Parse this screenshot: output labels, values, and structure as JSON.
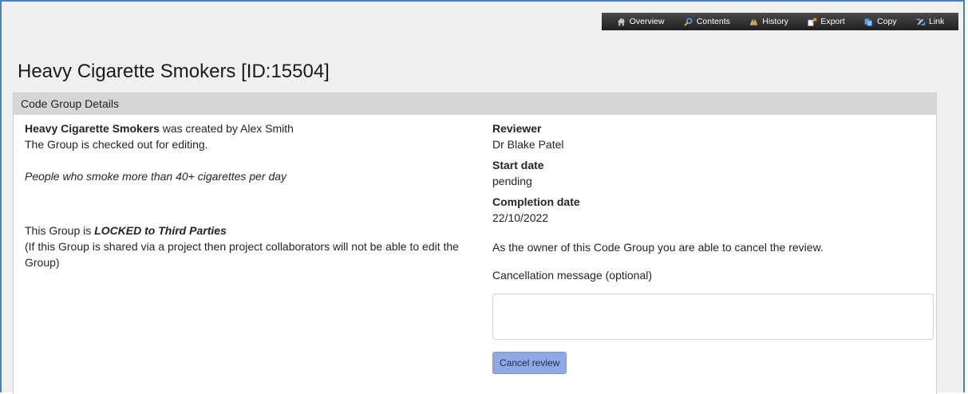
{
  "toolbar": {
    "items": [
      {
        "label": "Overview",
        "icon": "home-icon"
      },
      {
        "label": "Contents",
        "icon": "search-icon"
      },
      {
        "label": "History",
        "icon": "history-icon"
      },
      {
        "label": "Export",
        "icon": "export-icon"
      },
      {
        "label": "Copy",
        "icon": "copy-icon"
      },
      {
        "label": "Link",
        "icon": "link-icon"
      }
    ]
  },
  "page": {
    "title": "Heavy Cigarette Smokers [ID:15504]"
  },
  "panel": {
    "header": "Code Group Details",
    "left": {
      "group_name": "Heavy Cigarette Smokers",
      "created_by": " was created by Alex Smith",
      "checked_out": "The Group is checked out for editing.",
      "description": "People who smoke more than 40+ cigarettes per day",
      "lock_prefix": "This Group is ",
      "lock_status": "LOCKED to Third Parties",
      "lock_note": "(If this Group is shared via a project then project collaborators will not be able to edit the Group)"
    },
    "right": {
      "reviewer_label": "Reviewer",
      "reviewer_value": "Dr Blake Patel",
      "start_label": "Start date",
      "start_value": "pending",
      "completion_label": "Completion date",
      "completion_value": "22/10/2022",
      "owner_message": "As the owner of this Code Group you are able to cancel the review.",
      "cancel_message_label": "Cancellation message (optional)",
      "cancel_message_value": "",
      "cancel_button": "Cancel review"
    }
  },
  "colors": {
    "toolbar_bg": "#2b2b2b",
    "panel_header_bg": "#d6d6d6",
    "button_bg": "#8fa9e6",
    "frame_border": "#4a7fc1"
  }
}
